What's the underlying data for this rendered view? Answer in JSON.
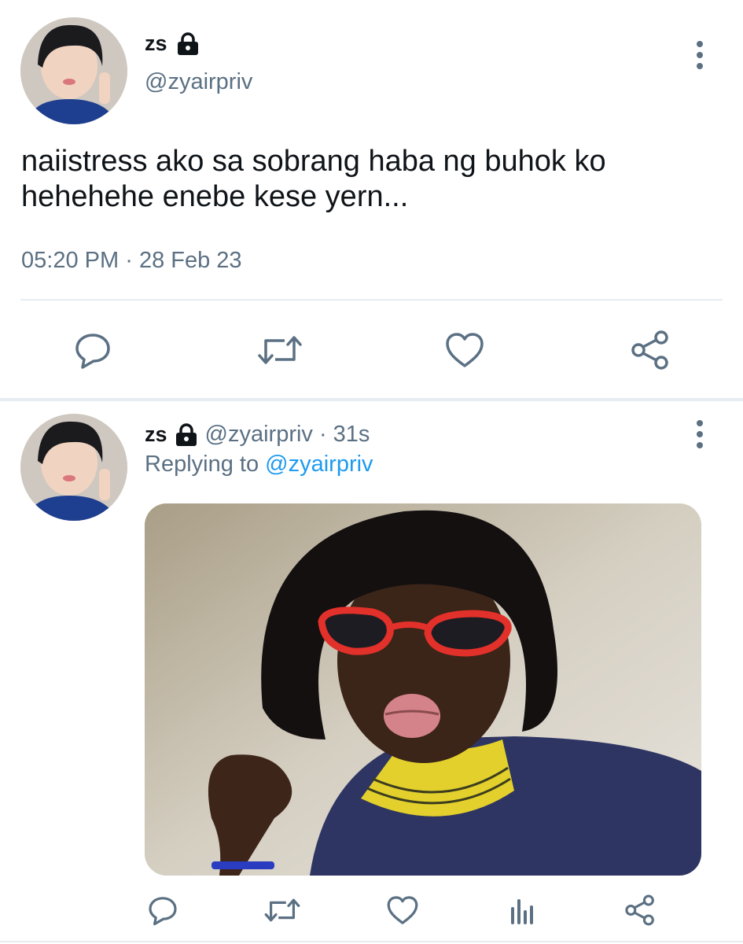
{
  "tweet": {
    "author": {
      "name": "zs",
      "handle": "@zyairpriv",
      "locked": true
    },
    "text_lines": [
      "naiistress ako sa sobrang haba ng buhok ko",
      "hehehehe enebe kese yern..."
    ],
    "time": "05:20 PM",
    "date": "28 Feb 23",
    "date_separator": "·",
    "actions": [
      "reply-icon",
      "retweet-icon",
      "like-icon",
      "share-icon"
    ]
  },
  "reply": {
    "author": {
      "name": "zs",
      "handle": "@zyairpriv",
      "locked": true
    },
    "age": "31s",
    "age_separator": "·",
    "replying_prefix": "Replying to",
    "replying_to": "@zyairpriv",
    "media": {
      "icon": "photo",
      "description_icon": "image"
    },
    "actions": [
      "reply-icon",
      "retweet-icon",
      "like-icon",
      "analytics-icon",
      "share-icon"
    ]
  },
  "colors": {
    "text": "#0f1419",
    "secondary": "#5b7083",
    "link": "#1d9bf0",
    "divider": "#e6ecf0"
  }
}
